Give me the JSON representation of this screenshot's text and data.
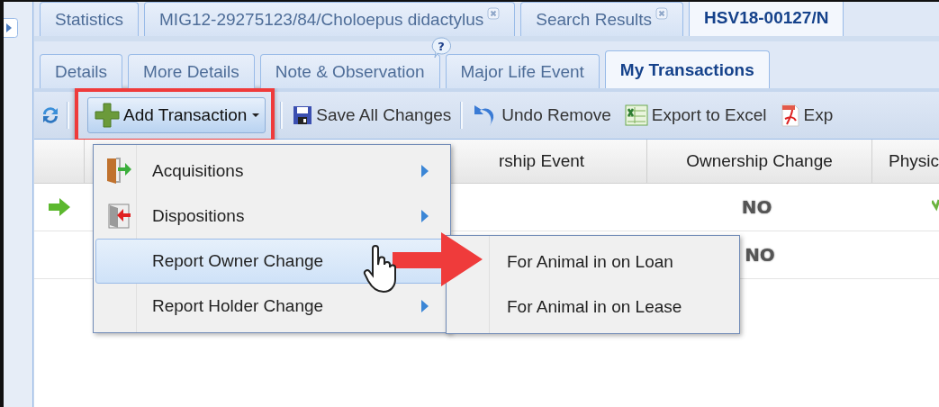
{
  "top_tabs": [
    {
      "label": "Statistics",
      "closable": false,
      "selected": false
    },
    {
      "label": "MIG12-29275123/84/Choloepus didactylus",
      "closable": true,
      "selected": false
    },
    {
      "label": "Search Results",
      "closable": true,
      "selected": false
    },
    {
      "label": "HSV18-00127/N",
      "closable": false,
      "selected": true
    }
  ],
  "sub_tabs": [
    {
      "label": "Details",
      "help": false,
      "selected": false
    },
    {
      "label": "More Details",
      "help": false,
      "selected": false
    },
    {
      "label": "Note & Observation",
      "help": true,
      "selected": false
    },
    {
      "label": "Major Life Event",
      "help": false,
      "selected": false
    },
    {
      "label": "My Transactions",
      "help": false,
      "selected": true
    }
  ],
  "help_badge": "?",
  "toolbar": [
    {
      "kind": "icon"
    },
    {
      "kind": "separator"
    },
    {
      "kind": "dropdown",
      "label": "Add Transaction",
      "highlighted": true
    },
    {
      "kind": "separator"
    },
    {
      "kind": "button",
      "label": "Save All Changes"
    },
    {
      "kind": "separator"
    },
    {
      "kind": "button",
      "label": "Undo Remove"
    },
    {
      "kind": "button",
      "label": "Export to Excel"
    },
    {
      "kind": "button",
      "label": "Exp"
    }
  ],
  "grid": {
    "columns": [
      "rship Event",
      "Ownership Change",
      "Physic"
    ],
    "rows": [
      {
        "current": true,
        "ownership_change": "NO",
        "physical_check": true
      },
      {
        "current": false,
        "ownership_change": "NO",
        "physical_check": false
      }
    ]
  },
  "menu": [
    {
      "label": "Acquisitions",
      "submenu_arrow": true,
      "selected": false
    },
    {
      "label": "Dispositions",
      "submenu_arrow": true,
      "selected": false
    },
    {
      "label": "Report Owner Change",
      "submenu_arrow": false,
      "selected": true
    },
    {
      "label": "Report Holder Change",
      "submenu_arrow": true,
      "selected": false
    }
  ],
  "submenu": [
    {
      "label": "For Animal in on Loan"
    },
    {
      "label": "For Animal in on Lease"
    }
  ]
}
